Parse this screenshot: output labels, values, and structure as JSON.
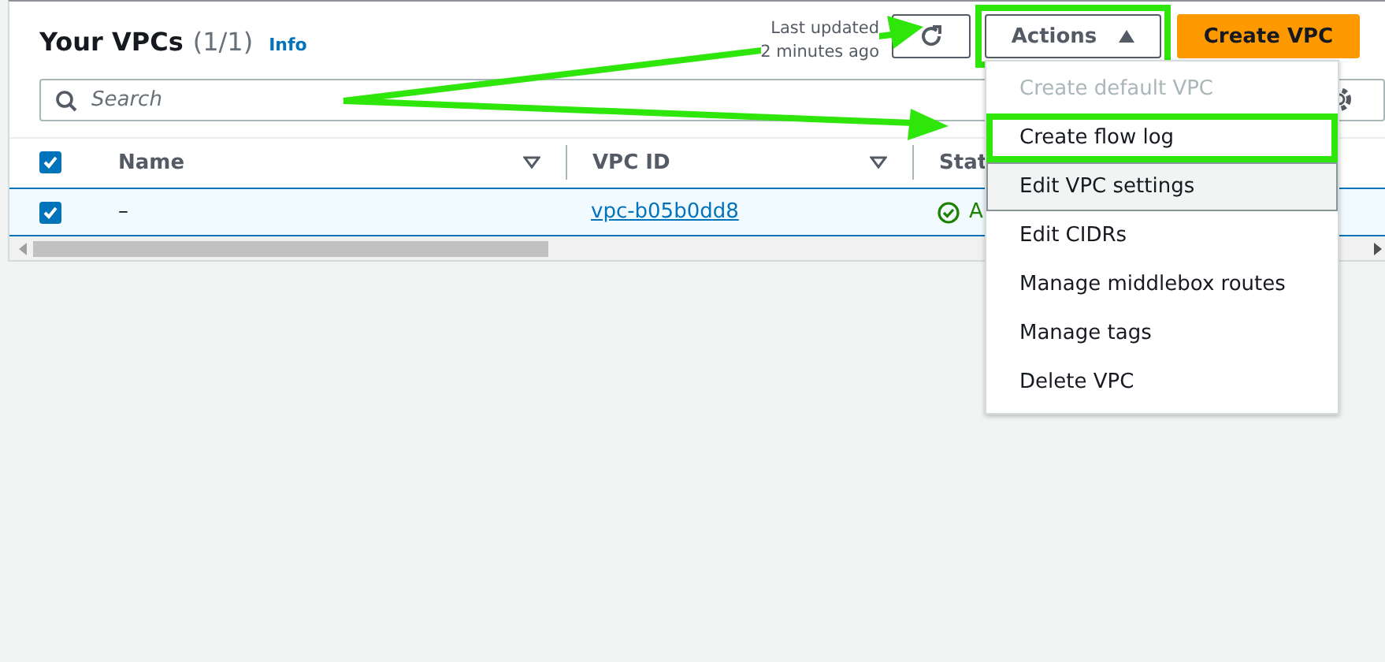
{
  "header": {
    "title": "Your VPCs",
    "count": "(1/1)",
    "info_link": "Info",
    "last_updated": [
      "Last updated",
      "2 minutes ago"
    ],
    "actions_button": {
      "label": "Actions",
      "expanded": true,
      "highlighted": true
    },
    "create_button": "Create VPC"
  },
  "search": {
    "placeholder": "Search"
  },
  "table": {
    "all_selected": true,
    "columns": [
      {
        "label": "Name",
        "sortable": true
      },
      {
        "label": "VPC ID",
        "sortable": true
      },
      {
        "label": "Stat",
        "sortable": false
      }
    ],
    "rows": [
      {
        "selected": true,
        "cells": [
          "–",
          "vpc-b05b0dd8",
          "A"
        ]
      }
    ]
  },
  "menu": [
    {
      "label": "Create default VPC",
      "disabled": true,
      "hovered": false,
      "highlighted": false
    },
    {
      "label": "Create flow log",
      "disabled": false,
      "hovered": false,
      "highlighted": true
    },
    {
      "label": "Edit VPC settings",
      "disabled": false,
      "hovered": true,
      "highlighted": false
    },
    {
      "label": "Edit CIDRs",
      "disabled": false,
      "hovered": false,
      "highlighted": false
    },
    {
      "label": "Manage middlebox routes",
      "disabled": false,
      "hovered": false,
      "highlighted": false
    },
    {
      "label": "Manage tags",
      "disabled": false,
      "hovered": false,
      "highlighted": false
    },
    {
      "label": "Delete VPC",
      "disabled": false,
      "hovered": false,
      "highlighted": false
    }
  ]
}
